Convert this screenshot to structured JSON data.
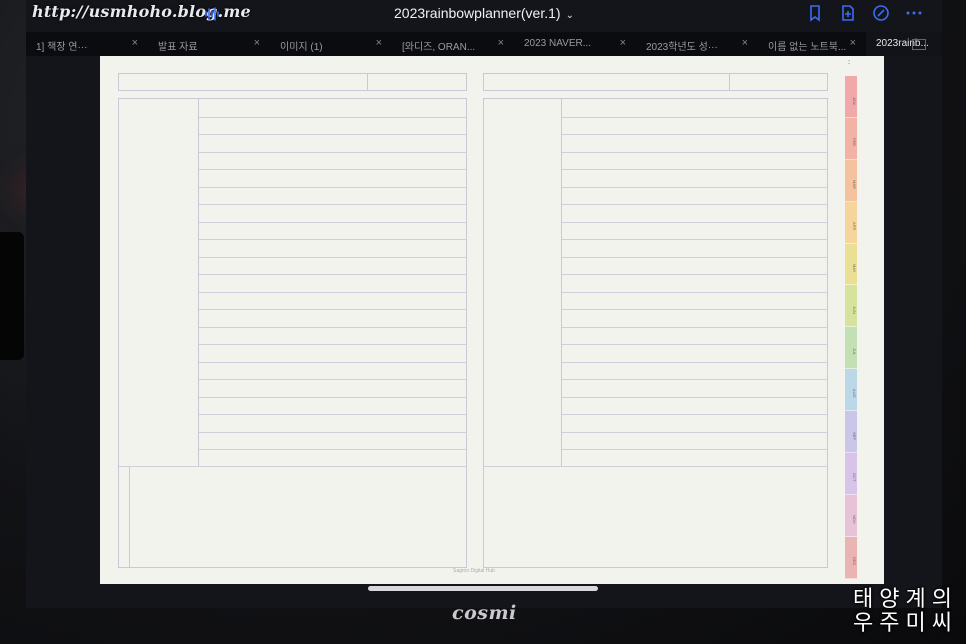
{
  "watermark": "http://usmhoho.blog.me",
  "toolbar": {
    "doc_title": "2023rainbowplanner(ver.1)",
    "accent": "#3a6cf4",
    "icons": [
      "waveform-icon",
      "bookmark-icon",
      "add-page-icon",
      "pen-off-icon",
      "more-icon"
    ]
  },
  "tabs": [
    {
      "label": "1] 책장 연···",
      "active": false
    },
    {
      "label": "발표 자료",
      "active": false
    },
    {
      "label": "이미지 (1)",
      "active": false
    },
    {
      "label": "[와디즈, ORAN...",
      "active": false
    },
    {
      "label": "2023 NAVER...",
      "active": false
    },
    {
      "label": "2023학년도 성···",
      "active": false
    },
    {
      "label": "이름 없는 노트북...",
      "active": false
    },
    {
      "label": "2023rainb...",
      "active": true
    }
  ],
  "tab_close": "×",
  "planner": {
    "footer_text": "Sagroo Digital Hub",
    "more": "::",
    "months": [
      "JAN",
      "FEB",
      "MAR",
      "APR",
      "MAY",
      "JUN",
      "JUL",
      "AUG",
      "SEP",
      "OCT",
      "NOV",
      "DEC"
    ],
    "month_colors": [
      "#f0a8a8",
      "#f2b2a6",
      "#f5c2a0",
      "#f6d59c",
      "#eadf94",
      "#d6e39c",
      "#c3e0b4",
      "#bcd7e8",
      "#c9c6ea",
      "#d8c4e8",
      "#e8c2d6",
      "#eab4b4"
    ]
  },
  "device_brand": "cosmi",
  "overlay": {
    "line1": "태양계의",
    "line2": "우주미씨"
  }
}
